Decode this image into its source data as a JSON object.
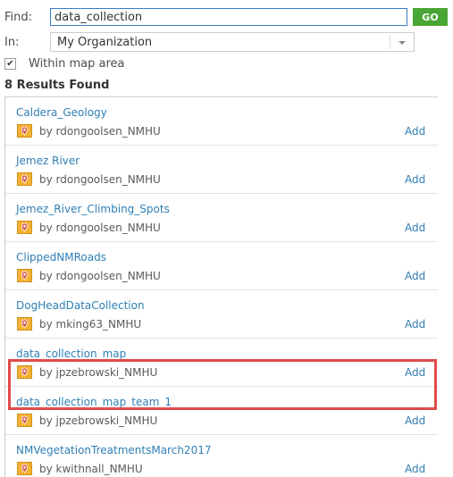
{
  "search": {
    "find_label": "Find:",
    "find_value": "data_collection",
    "go_label": "GO",
    "in_label": "In:",
    "in_value": "My Organization",
    "within_checked": true,
    "within_label": "Within map area"
  },
  "results": {
    "count_label": "8 Results Found",
    "add_label": "Add",
    "items": [
      {
        "title": "Caldera_Geology",
        "owner": "by rdongoolsen_NMHU",
        "highlighted": false
      },
      {
        "title": "Jemez River",
        "owner": "by rdongoolsen_NMHU",
        "highlighted": false
      },
      {
        "title": "Jemez_River_Climbing_Spots",
        "owner": "by rdongoolsen_NMHU",
        "highlighted": false
      },
      {
        "title": "ClippedNMRoads",
        "owner": "by rdongoolsen_NMHU",
        "highlighted": false
      },
      {
        "title": "DogHeadDataCollection",
        "owner": "by mking63_NMHU",
        "highlighted": false
      },
      {
        "title": "data_collection_map",
        "owner": "by jpzebrowski_NMHU",
        "highlighted": false
      },
      {
        "title": "data_collection_map_team_1",
        "owner": "by jpzebrowski_NMHU",
        "highlighted": true
      },
      {
        "title": "NMVegetationTreatmentsMarch2017",
        "owner": "by kwithnall_NMHU",
        "highlighted": false
      }
    ]
  },
  "colors": {
    "link": "#2f7fb5",
    "go_button": "#4aa634",
    "highlight": "#e04a4a",
    "item_icon": "#f2b233"
  },
  "icons": {
    "item_icon": "web-map-icon",
    "checkbox": "checkmark-icon",
    "dropdown": "chevron-down-icon"
  }
}
